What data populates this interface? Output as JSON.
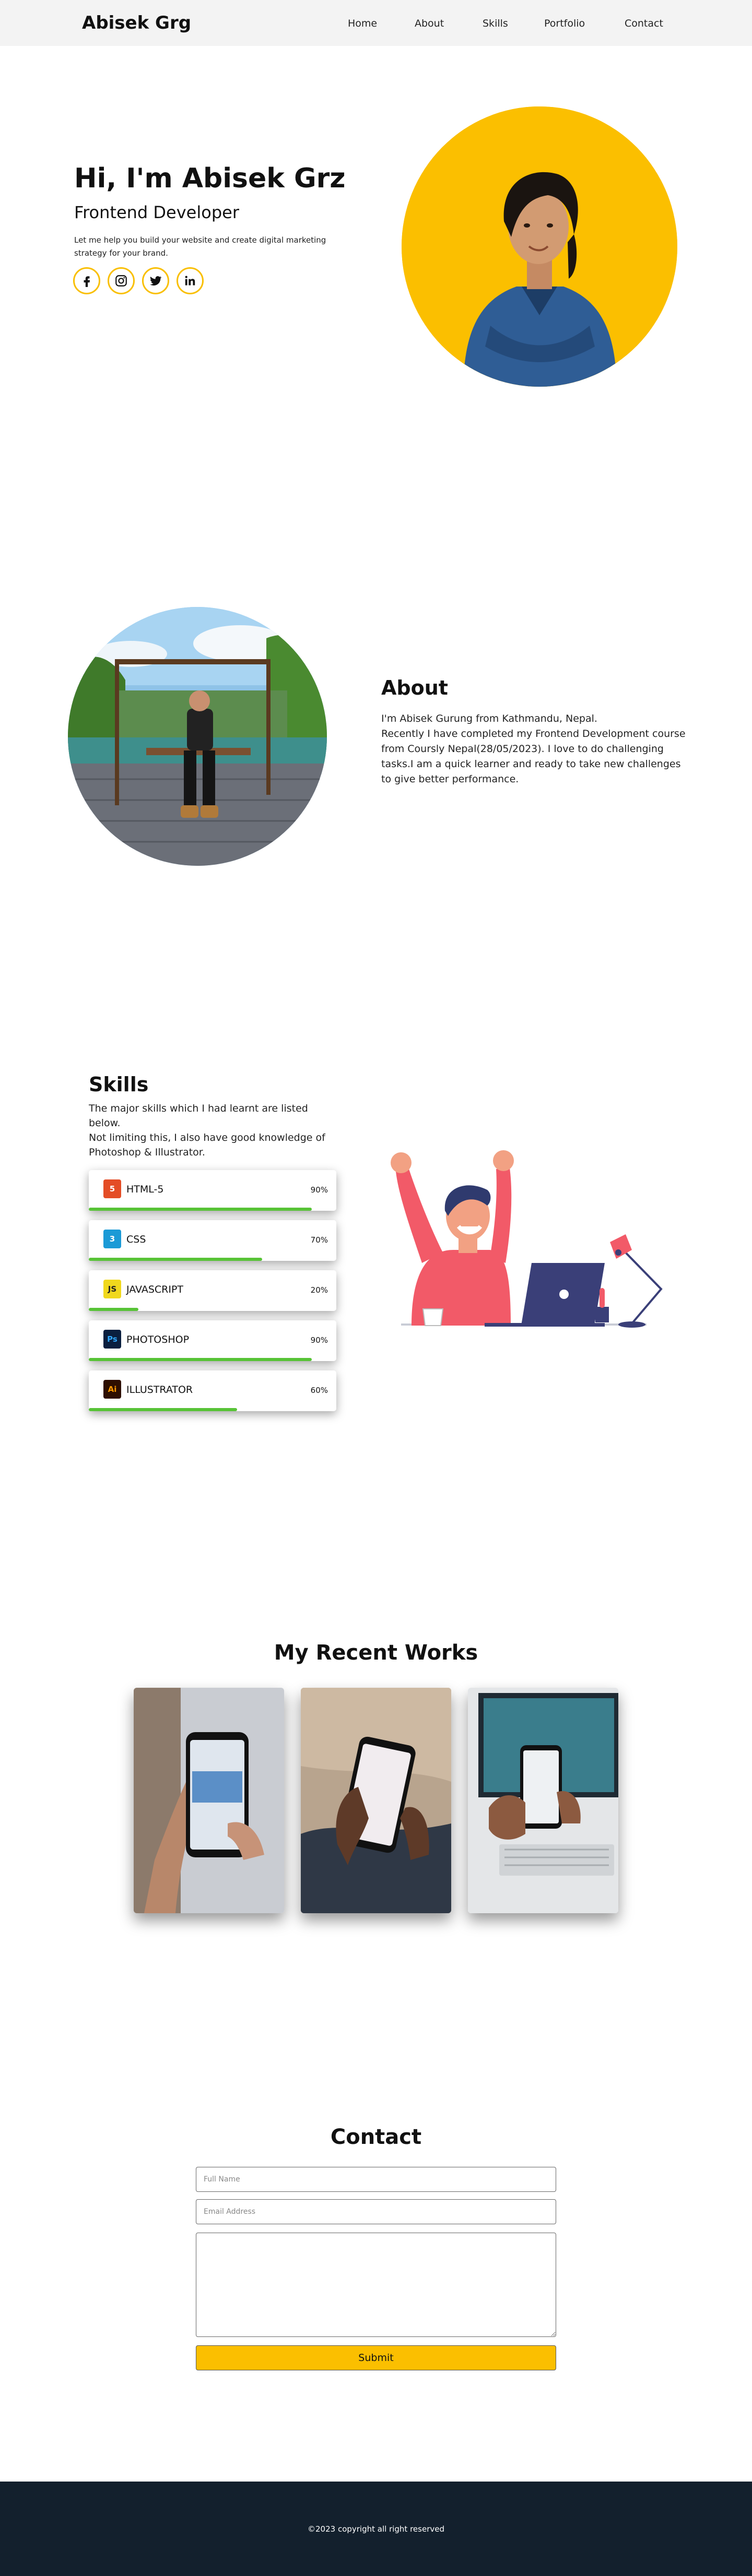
{
  "nav": {
    "logo": "Abisek Grg",
    "links": [
      "Home",
      "About",
      "Skills",
      "Portfolio",
      "Contact"
    ]
  },
  "hero": {
    "title": "Hi, I'm Abisek Grz",
    "subtitle": "Frontend Developer",
    "description": "Let me help you build your website and create digital marketing strategy for your brand.",
    "socials": [
      "facebook-icon",
      "instagram-icon",
      "twitter-icon",
      "linkedin-icon"
    ],
    "accent": "#fbbf00"
  },
  "about": {
    "title": "About",
    "line1": "I'm Abisek Gurung from Kathmandu, Nepal.",
    "line2": "Recently I have completed my Frontend Development course from Coursly Nepal(28/05/2023). I love to do challenging tasks.I am a quick learner and ready to take new challenges to give better performance."
  },
  "skills": {
    "title": "Skills",
    "line1": "The major skills which I had learnt are listed below.",
    "line2": "Not limiting this, I also have good knowledge of Photoshop & Illustrator.",
    "items": [
      {
        "name": "HTML-5",
        "percent": "90%",
        "level": 0.9,
        "icon": "html5-icon",
        "color": "#e44d26"
      },
      {
        "name": "CSS",
        "percent": "70%",
        "level": 0.7,
        "icon": "css3-icon",
        "color": "#1b9ad6"
      },
      {
        "name": "JAVASCRIPT",
        "percent": "20%",
        "level": 0.2,
        "icon": "javascript-icon",
        "color": "#f0d81d"
      },
      {
        "name": "PHOTOSHOP",
        "percent": "90%",
        "level": 0.9,
        "icon": "photoshop-icon",
        "color": "#0a1f3f"
      },
      {
        "name": "ILLUSTRATOR",
        "percent": "60%",
        "level": 0.6,
        "icon": "illustrator-icon",
        "color": "#2e0f00"
      }
    ],
    "bar_color": "#57c336"
  },
  "works": {
    "title": "My Recent Works"
  },
  "contact": {
    "title": "Contact",
    "name_placeholder": "Full Name",
    "email_placeholder": "Email Address",
    "message_placeholder": "",
    "submit_label": "Submit"
  },
  "footer": {
    "text": "©2023 copyright all right reserved"
  }
}
